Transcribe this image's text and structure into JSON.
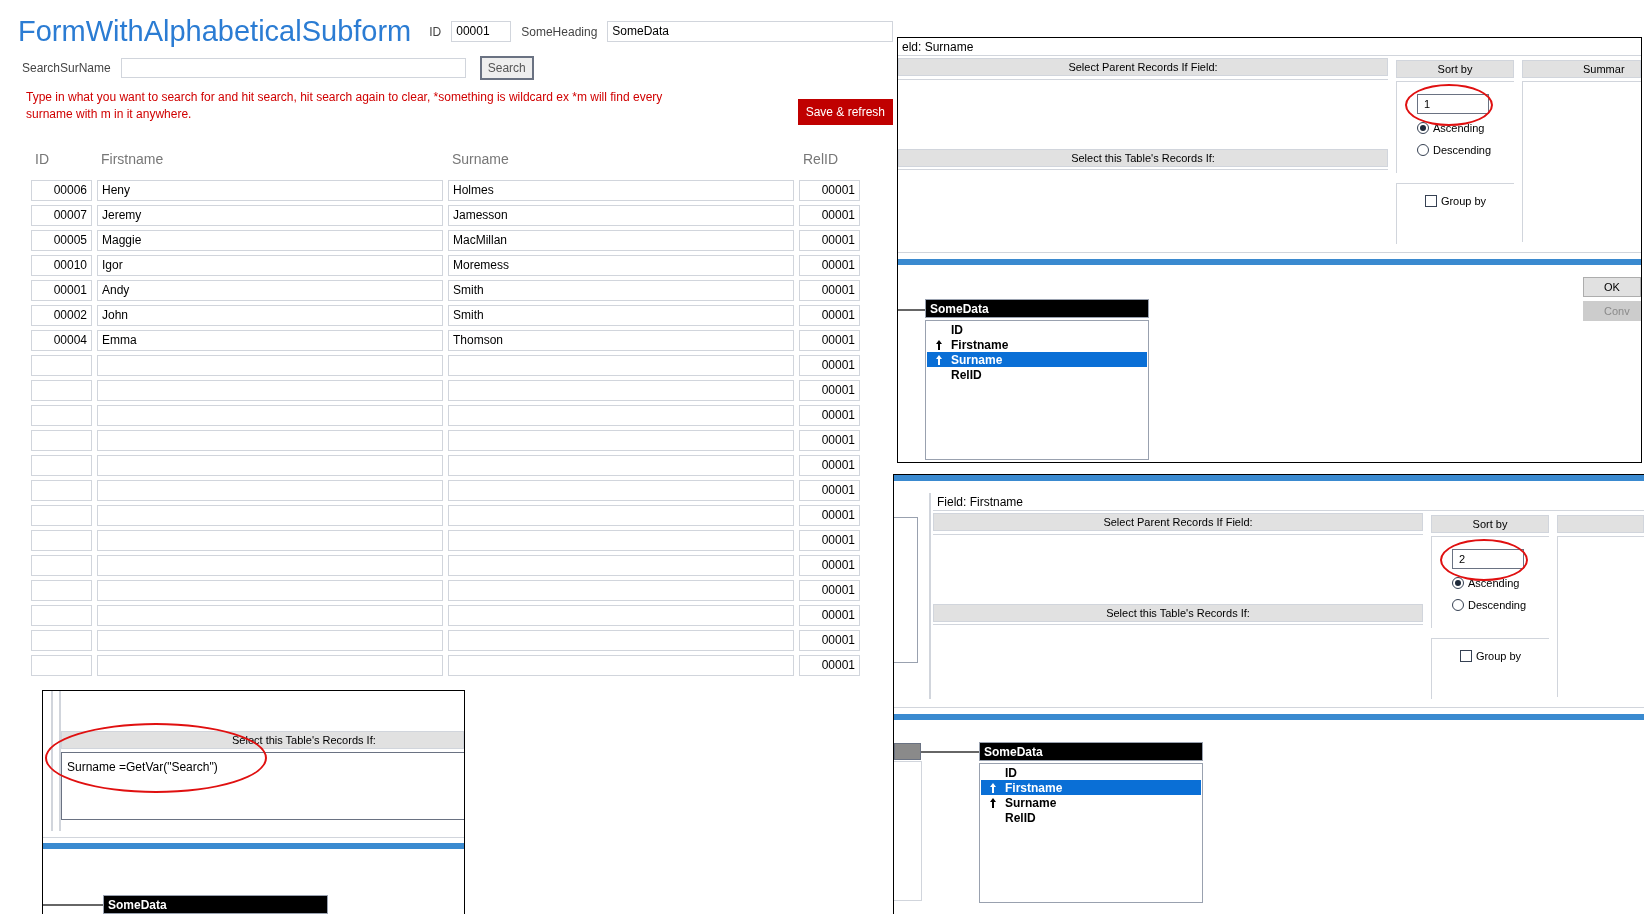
{
  "form": {
    "title": "FormWithAlphabeticalSubform",
    "id_label": "ID",
    "id_value": "00001",
    "heading_label": "SomeHeading",
    "heading_value": "SomeData",
    "search_label": "SearchSurName",
    "search_button": "Search",
    "hint": "Type in what you want to search for and hit search, hit search again to clear, *something is wildcard ex *m will find every surname with m in it anywhere.",
    "save_button": "Save & refresh"
  },
  "table": {
    "columns": [
      "ID",
      "Firstname",
      "Surname",
      "RelID"
    ],
    "rows": [
      {
        "id": "00006",
        "firstname": "Heny",
        "surname": "Holmes",
        "relid": "00001"
      },
      {
        "id": "00007",
        "firstname": "Jeremy",
        "surname": "Jamesson",
        "relid": "00001"
      },
      {
        "id": "00005",
        "firstname": "Maggie",
        "surname": "MacMillan",
        "relid": "00001"
      },
      {
        "id": "00010",
        "firstname": "Igor",
        "surname": "Moremess",
        "relid": "00001"
      },
      {
        "id": "00001",
        "firstname": "Andy",
        "surname": "Smith",
        "relid": "00001"
      },
      {
        "id": "00002",
        "firstname": "John",
        "surname": "Smith",
        "relid": "00001"
      },
      {
        "id": "00004",
        "firstname": "Emma",
        "surname": "Thomson",
        "relid": "00001"
      },
      {
        "relid": "00001"
      },
      {
        "relid": "00001"
      },
      {
        "relid": "00001"
      },
      {
        "relid": "00001"
      },
      {
        "relid": "00001"
      },
      {
        "relid": "00001"
      },
      {
        "relid": "00001"
      },
      {
        "relid": "00001"
      },
      {
        "relid": "00001"
      },
      {
        "relid": "00001"
      },
      {
        "relid": "00001"
      },
      {
        "relid": "00001"
      },
      {
        "relid": "00001"
      }
    ]
  },
  "criteria_panel": {
    "header": "Select this Table's Records If:",
    "criteria": "Surname =GetVar(\"Search\")",
    "table_title": "SomeData"
  },
  "panels": [
    {
      "field_label": "eld: Surname",
      "parent_header": "Select Parent Records If Field:",
      "table_header": "Select this Table's Records If:",
      "sort_header": "Sort by",
      "summary_header": "Summar",
      "sort_value": "1",
      "orders": [
        {
          "label": "Ascending",
          "selected": true
        },
        {
          "label": "Descending",
          "selected": false
        }
      ],
      "group_by": {
        "label": "Group by",
        "checked": false
      },
      "buttons": [
        {
          "label": "OK",
          "disabled": false
        },
        {
          "label": "Conv",
          "disabled": true
        }
      ],
      "table": {
        "title": "SomeData",
        "fields": [
          {
            "name": "ID",
            "sorted": false,
            "selected": false
          },
          {
            "name": "Firstname",
            "sorted": true,
            "selected": false
          },
          {
            "name": "Surname",
            "sorted": true,
            "selected": true
          },
          {
            "name": "RelID",
            "sorted": false,
            "selected": false
          }
        ]
      }
    },
    {
      "field_label": "Field: Firstname",
      "parent_header": "Select Parent Records If Field:",
      "table_header": "Select this Table's Records If:",
      "sort_header": "Sort by",
      "sort_value": "2",
      "orders": [
        {
          "label": "Ascending",
          "selected": true
        },
        {
          "label": "Descending",
          "selected": false
        }
      ],
      "group_by": {
        "label": "Group by",
        "checked": false
      },
      "table": {
        "title": "SomeData",
        "fields": [
          {
            "name": "ID",
            "sorted": false,
            "selected": false
          },
          {
            "name": "Firstname",
            "sorted": true,
            "selected": true
          },
          {
            "name": "Surname",
            "sorted": true,
            "selected": false
          },
          {
            "name": "RelID",
            "sorted": false,
            "selected": false
          }
        ]
      }
    }
  ]
}
